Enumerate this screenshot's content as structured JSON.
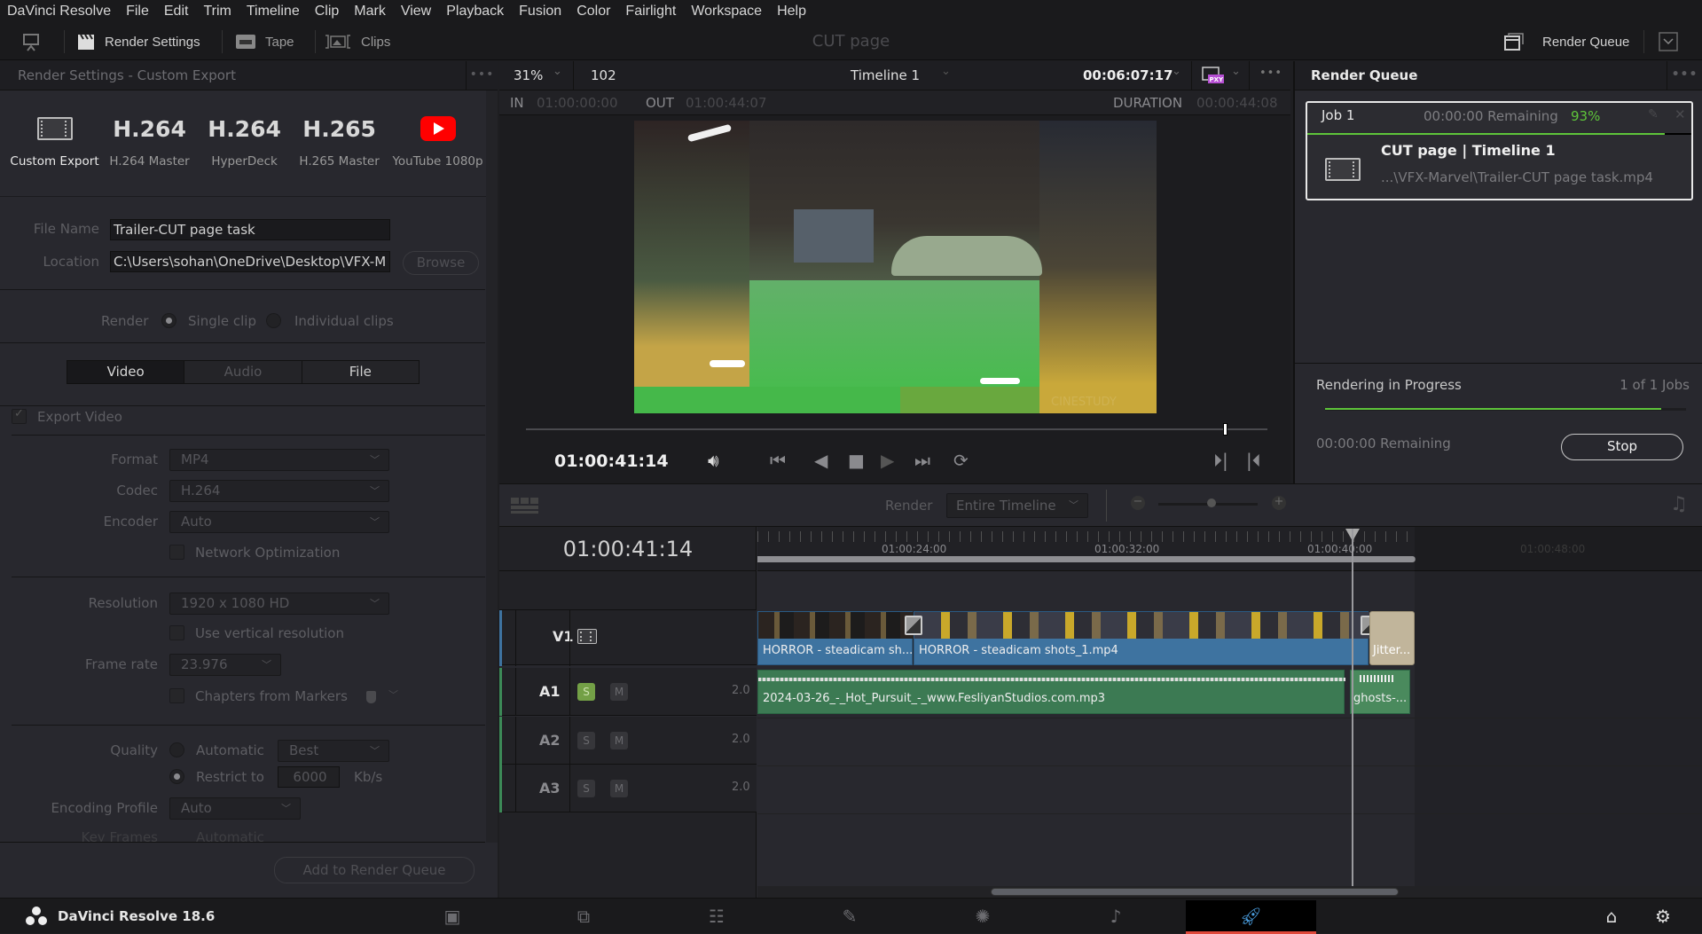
{
  "menu": [
    "DaVinci Resolve",
    "File",
    "Edit",
    "Trim",
    "Timeline",
    "Clip",
    "Mark",
    "View",
    "Playback",
    "Fusion",
    "Color",
    "Fairlight",
    "Workspace",
    "Help"
  ],
  "toolbar": {
    "render_settings": "Render Settings",
    "tape": "Tape",
    "clips": "Clips",
    "page_title": "CUT page",
    "render_queue": "Render Queue"
  },
  "render_settings": {
    "title": "Render Settings - Custom Export",
    "presets": [
      {
        "big": "",
        "label": "Custom Export",
        "icon": "film-icon",
        "selected": true
      },
      {
        "big": "H.264",
        "label": "H.264 Master"
      },
      {
        "big": "H.264",
        "label": "HyperDeck"
      },
      {
        "big": "H.265",
        "label": "H.265 Master"
      },
      {
        "big": "",
        "label": "YouTube 1080p",
        "icon": "youtube-icon"
      }
    ],
    "file_name_label": "File Name",
    "file_name": "Trailer-CUT page task",
    "location_label": "Location",
    "location": "C:\\Users\\sohan\\OneDrive\\Desktop\\VFX-M",
    "browse": "Browse",
    "render_label": "Render",
    "single_clip": "Single clip",
    "individual_clips": "Individual clips",
    "tabs": [
      "Video",
      "Audio",
      "File"
    ],
    "export_video": "Export Video",
    "format_label": "Format",
    "format": "MP4",
    "codec_label": "Codec",
    "codec": "H.264",
    "encoder_label": "Encoder",
    "encoder": "Auto",
    "network_opt": "Network Optimization",
    "resolution_label": "Resolution",
    "resolution": "1920 x 1080 HD",
    "vertical_res": "Use vertical resolution",
    "frame_rate_label": "Frame rate",
    "frame_rate": "23.976",
    "chapters": "Chapters from Markers",
    "quality_label": "Quality",
    "automatic": "Automatic",
    "best": "Best",
    "restrict_to": "Restrict to",
    "bitrate": "6000",
    "kbs": "Kb/s",
    "encoding_profile_label": "Encoding Profile",
    "encoding_profile": "Auto",
    "key_frames_label": "Key Frames",
    "key_frames": "Automatic",
    "add_to_queue": "Add to Render Queue"
  },
  "viewer": {
    "zoom": "31%",
    "frame": "102",
    "timeline": "Timeline 1",
    "timecode": "00:06:07:17",
    "in_label": "IN",
    "in": "01:00:00:00",
    "out_label": "OUT",
    "out": "01:00:44:07",
    "duration_label": "DURATION",
    "duration": "00:00:44:08",
    "current_tc": "01:00:41:14",
    "scrub_position": 0.94,
    "watermark": "CINESTUDY"
  },
  "render_queue": {
    "title": "Render Queue",
    "job": {
      "name": "Job 1",
      "remaining": "00:00:00 Remaining",
      "percent": "93%",
      "progress": 0.93,
      "title": "CUT page | Timeline 1",
      "path": "...\\VFX-Marvel\\Trailer-CUT page task.mp4"
    },
    "status": "Rendering in Progress",
    "jobs_count": "1 of 1 Jobs",
    "overall_progress": 0.93,
    "remaining": "00:00:00 Remaining",
    "stop": "Stop",
    "accent": "#5ec43a"
  },
  "timeline": {
    "render_label": "Render",
    "render_range": "Entire Timeline",
    "timecode": "01:00:41:14",
    "ruler": [
      "01:00:24:00",
      "01:00:32:00",
      "01:00:40:00",
      "01:00:48:00"
    ],
    "tracks": [
      {
        "name": "V1",
        "type": "video"
      },
      {
        "name": "A1",
        "type": "audio",
        "level": "2.0",
        "solo": true
      },
      {
        "name": "A2",
        "type": "audio",
        "level": "2.0"
      },
      {
        "name": "A3",
        "type": "audio",
        "level": "2.0"
      }
    ],
    "solo": "S",
    "mute": "M",
    "video_clips": [
      "HORROR - steadicam sh...",
      "HORROR - steadicam shots_1.mp4",
      "Jitter..."
    ],
    "audio_clips": [
      "2024-03-26_-_Hot_Pursuit_-_www.FesliyanStudios.com.mp3",
      "ghosts-..."
    ]
  },
  "footer": {
    "app": "DaVinci Resolve 18.6"
  }
}
